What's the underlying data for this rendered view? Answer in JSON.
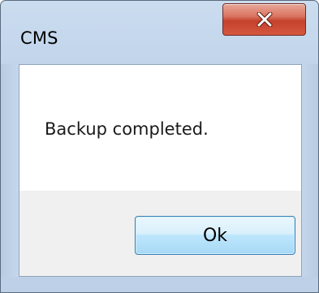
{
  "window": {
    "title": "CMS",
    "close_icon": "close-icon",
    "colors": {
      "frame": "#bcd0e8",
      "close_button": "#c4412b",
      "ok_button": "#bee6fd",
      "message_background": "#ffffff",
      "button_area_background": "#f0f0f0"
    }
  },
  "dialog": {
    "message": "Backup completed.",
    "ok_label": "Ok"
  }
}
